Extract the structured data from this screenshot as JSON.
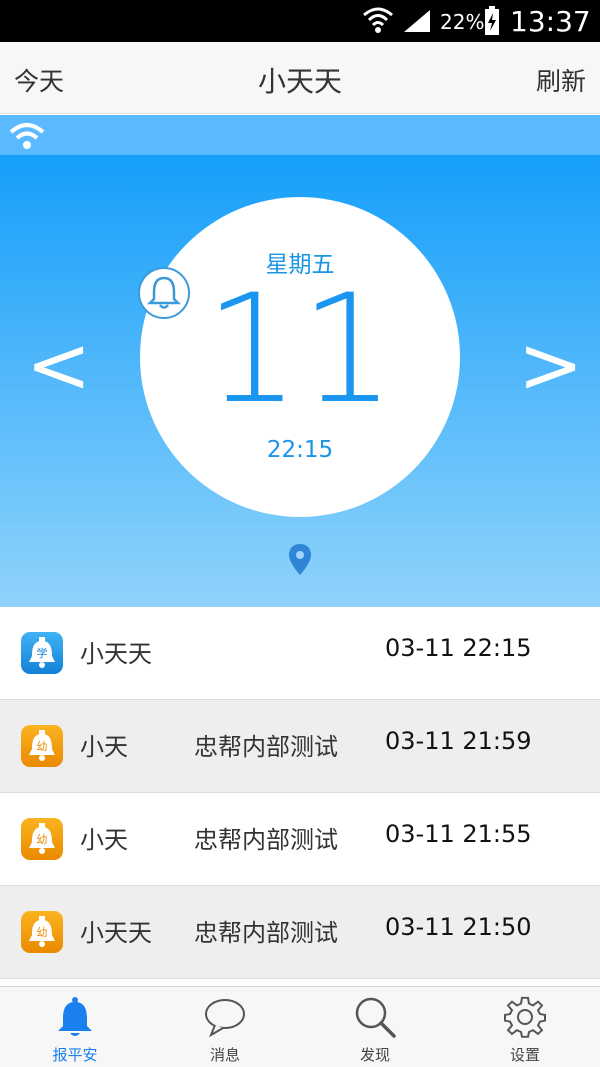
{
  "status_bar": {
    "battery_percent": "22%",
    "clock": "13:37"
  },
  "nav": {
    "left": "今天",
    "title": "小天天",
    "right": "刷新"
  },
  "hero": {
    "prev_arrow": "<",
    "next_arrow": ">",
    "weekday": "星期五",
    "day": "11",
    "time": "22:15"
  },
  "records": [
    {
      "icon": "student-bell-icon",
      "icon_char": "学",
      "name": "小天天",
      "group": "",
      "time": "03-11 22:15"
    },
    {
      "icon": "kindergarten-bell-icon",
      "icon_char": "幼",
      "name": "小天",
      "group": "忠帮内部测试",
      "time": "03-11 21:59"
    },
    {
      "icon": "kindergarten-bell-icon",
      "icon_char": "幼",
      "name": "小天",
      "group": "忠帮内部测试",
      "time": "03-11 21:55"
    },
    {
      "icon": "kindergarten-bell-icon",
      "icon_char": "幼",
      "name": "小天天",
      "group": "忠帮内部测试",
      "time": "03-11 21:50"
    }
  ],
  "tabs": [
    {
      "label": "报平安",
      "icon": "bell-icon",
      "active": true
    },
    {
      "label": "消息",
      "icon": "chat-bubble-icon",
      "active": false
    },
    {
      "label": "发现",
      "icon": "search-icon",
      "active": false
    },
    {
      "label": "设置",
      "icon": "gear-icon",
      "active": false
    }
  ],
  "colors": {
    "accent": "#1a95f0",
    "tab_active": "#1a80f0",
    "hero_top": "#159ff9",
    "hero_bottom": "#8fd3fb",
    "orange_icon": "#f5a100"
  }
}
